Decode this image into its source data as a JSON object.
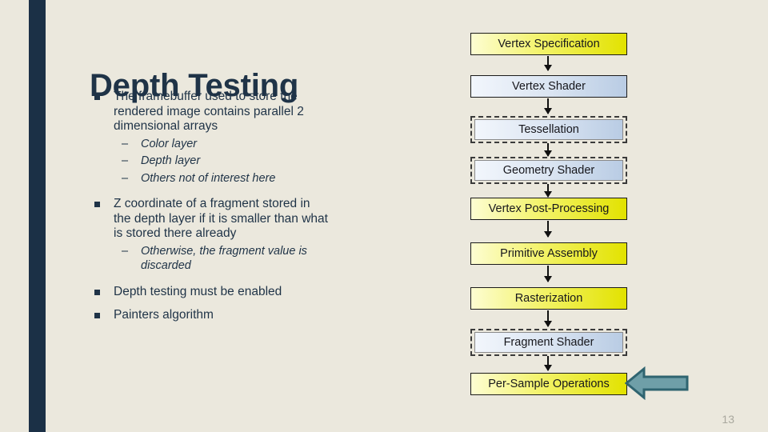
{
  "slide": {
    "title": "Depth Testing",
    "page_number": "13",
    "accent_stripe_color": "#1b3046",
    "background_color": "#ebe8dd",
    "title_color": "#1f3347"
  },
  "body": {
    "bullets": [
      {
        "level": 1,
        "marker": "square",
        "text_normal": "The framebuffer used to store the rendered image contains parallel 2 dimensional arrays",
        "text_italic": ""
      },
      {
        "level": 2,
        "marker": "–",
        "text_normal": "",
        "text_italic": "Color layer"
      },
      {
        "level": 2,
        "marker": "–",
        "text_normal": "",
        "text_italic": "Depth layer"
      },
      {
        "level": 2,
        "marker": "–",
        "text_normal": "",
        "text_italic": "Others not of interest here"
      },
      {
        "level": 1,
        "marker": "square",
        "text_normal": "Z coordinate of a fragment stored in the depth layer ",
        "text_italic": "if it is smaller than what is stored there already"
      },
      {
        "level": 2,
        "marker": "–",
        "text_normal": "",
        "text_italic": "Otherwise, the fragment value is discarded"
      },
      {
        "level": 1,
        "marker": "square",
        "text_normal": "Depth testing must be enabled",
        "text_italic": ""
      },
      {
        "level": 1,
        "marker": "square",
        "text_normal": "Painters algorithm",
        "text_italic": ""
      }
    ]
  },
  "pipeline": {
    "stages": [
      {
        "label": "Vertex Specification",
        "style": "yellow",
        "border": "solid"
      },
      {
        "label": "Vertex Shader",
        "style": "blue",
        "border": "solid"
      },
      {
        "label": "Tessellation",
        "style": "blue",
        "border": "dashed"
      },
      {
        "label": "Geometry Shader",
        "style": "blue",
        "border": "dashed"
      },
      {
        "label": "Vertex Post-Processing",
        "style": "yellow",
        "border": "solid"
      },
      {
        "label": "Primitive Assembly",
        "style": "yellow",
        "border": "solid"
      },
      {
        "label": "Rasterization",
        "style": "yellow",
        "border": "solid"
      },
      {
        "label": "Fragment Shader",
        "style": "blue",
        "border": "dashed"
      },
      {
        "label": "Per-Sample Operations",
        "style": "yellow",
        "border": "solid"
      }
    ],
    "callout": {
      "points_to": "Per-Sample Operations",
      "direction": "left",
      "fill_color": "#6f9fa8",
      "outline_color": "#2f6470"
    },
    "colors": {
      "yellow_start": "#fdfdd2",
      "yellow_end": "#e2e200",
      "blue_start": "#f2f6fc",
      "blue_end": "#b9cce4",
      "box_border": "#1b1b1b",
      "dashed_border": "#3b3b3b"
    }
  }
}
